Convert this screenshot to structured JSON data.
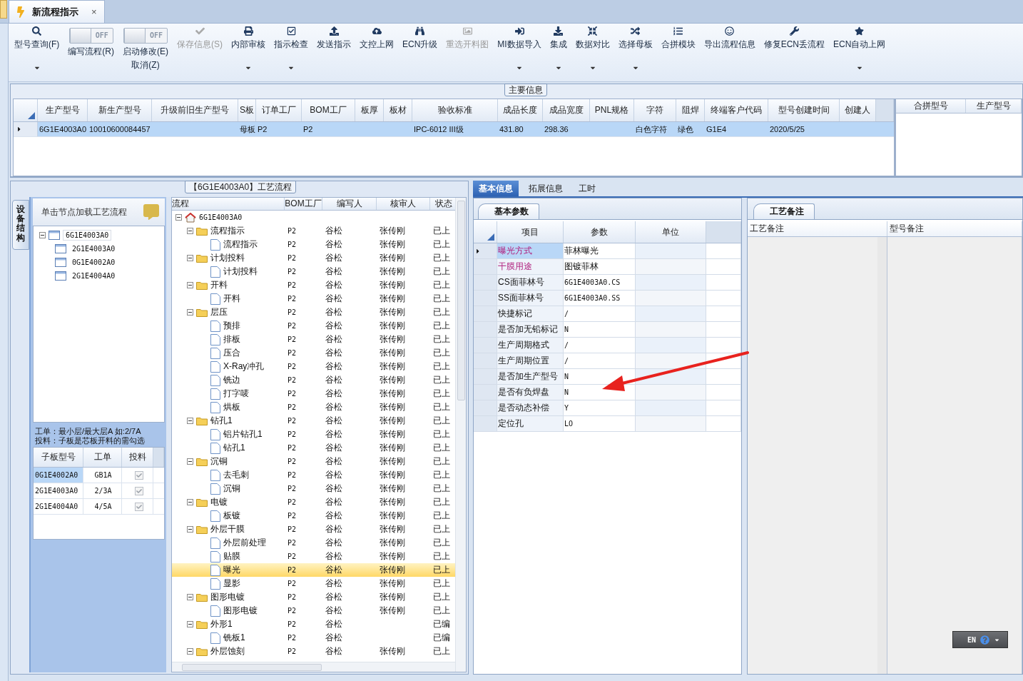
{
  "tab_strip": {
    "tabs": [
      {
        "label": "新流程指示",
        "close": "×",
        "selected": true
      }
    ]
  },
  "toolbar": [
    {
      "kind": "button",
      "label": "型号查询(F)",
      "dropdown": true,
      "disabled": false
    },
    {
      "kind": "toggle",
      "switch_text": "OFF",
      "on": false,
      "label": "编写流程(R)"
    },
    {
      "kind": "toggle",
      "switch_text": "OFF",
      "on": false,
      "label": "启动修改(E)",
      "label_2": "取消(Z)"
    },
    {
      "kind": "button",
      "label": "保存信息(S)",
      "dropdown": false,
      "disabled": true
    },
    {
      "kind": "button",
      "label": "内部审核",
      "dropdown": true,
      "disabled": false
    },
    {
      "kind": "button",
      "label": "指示检查",
      "dropdown": true,
      "disabled": false
    },
    {
      "kind": "button",
      "label": "发送指示",
      "dropdown": false,
      "disabled": false
    },
    {
      "kind": "button",
      "label": "文控上网",
      "dropdown": false,
      "disabled": false
    },
    {
      "kind": "button",
      "label": "ECN升级",
      "dropdown": false,
      "disabled": false
    },
    {
      "kind": "button",
      "label": "重选开料图",
      "dropdown": false,
      "disabled": true
    },
    {
      "kind": "button",
      "label": "MI数据导入",
      "dropdown": true,
      "disabled": false
    },
    {
      "kind": "button",
      "label": "集成",
      "dropdown": true,
      "disabled": false
    },
    {
      "kind": "button",
      "label": "数据对比",
      "dropdown": true,
      "disabled": false
    },
    {
      "kind": "button",
      "label": "选择母板",
      "dropdown": true,
      "disabled": false
    },
    {
      "kind": "button",
      "label": "合拼模块",
      "dropdown": false,
      "disabled": false
    },
    {
      "kind": "button",
      "label": "导出流程信息",
      "dropdown": false,
      "disabled": false
    },
    {
      "kind": "button",
      "label": "修复ECN丢流程",
      "dropdown": false,
      "disabled": false
    },
    {
      "kind": "button",
      "label": "ECN自动上网",
      "dropdown": true,
      "disabled": false
    }
  ],
  "main_info": {
    "legend": "主要信息",
    "columns": [
      "生产型号",
      "新生产型号",
      "升级前旧生产型号",
      "S板",
      "订单工厂",
      "BOM工厂",
      "板厚",
      "板材",
      "验收标准",
      "成品长度",
      "成品宽度",
      "PNL规格",
      "字符",
      "阻焊",
      "终端客户代码",
      "型号创建时间",
      "创建人"
    ],
    "rows": [
      {
        "selected": true,
        "cells": [
          "6G1E4003A0",
          "10010600084457",
          null,
          "母板",
          "P2",
          "P2",
          null,
          null,
          "IPC-6012 III级",
          "431.80",
          "298.36",
          null,
          "白色字符",
          "绿色",
          "G1E4",
          "2020/5/25",
          null
        ]
      }
    ],
    "side_columns": [
      "合拼型号",
      "生产型号"
    ]
  },
  "process": {
    "legend": "【6G1E4003A0】工艺流程",
    "side_tab": "设备结构",
    "hint": "单击节点加载工艺流程",
    "structure_tree": [
      {
        "label": "6G1E4003A0",
        "expanded": true,
        "children": [
          {
            "label": "2G1E4003A0"
          },
          {
            "label": "0G1E4002A0"
          },
          {
            "label": "2G1E4004A0"
          }
        ]
      }
    ],
    "note": [
      "工单：最小层/最大层A 如:2/7A",
      "投料：子板是芯板开料的需勾选"
    ],
    "sub_boards": {
      "columns": [
        "子板型号",
        "工单",
        "投料"
      ],
      "rows": [
        {
          "board": "0G1E4002A0",
          "order": "GB1A",
          "feed": true,
          "selected": true
        },
        {
          "board": "2G1E4003A0",
          "order": "2/3A",
          "feed": true,
          "selected": false
        },
        {
          "board": "2G1E4004A0",
          "order": "4/5A",
          "feed": true,
          "selected": false
        }
      ]
    },
    "flow_grid": {
      "columns": [
        "流程",
        "BOM工厂",
        "编写人",
        "核审人",
        "状态"
      ],
      "tree": [
        {
          "kind": "root",
          "label": "6G1E4003A0",
          "expanded": true,
          "selected": false,
          "children": [
            {
              "kind": "folder",
              "label": "流程指示",
              "expanded": true,
              "bom": "P2",
              "writer": "谷松",
              "reviewer": "张传刚",
              "status": "已上",
              "selected": false,
              "children": [
                {
                  "kind": "file",
                  "label": "流程指示",
                  "bom": "P2",
                  "writer": "谷松",
                  "reviewer": "张传刚",
                  "status": "已上",
                  "selected": false
                }
              ]
            },
            {
              "kind": "folder",
              "label": "计划投料",
              "expanded": true,
              "bom": "P2",
              "writer": "谷松",
              "reviewer": "张传刚",
              "status": "已上",
              "selected": false,
              "children": [
                {
                  "kind": "file",
                  "label": "计划投料",
                  "bom": "P2",
                  "writer": "谷松",
                  "reviewer": "张传刚",
                  "status": "已上",
                  "selected": false
                }
              ]
            },
            {
              "kind": "folder",
              "label": "开料",
              "expanded": true,
              "bom": "P2",
              "writer": "谷松",
              "reviewer": "张传刚",
              "status": "已上",
              "selected": false,
              "children": [
                {
                  "kind": "file",
                  "label": "开料",
                  "bom": "P2",
                  "writer": "谷松",
                  "reviewer": "张传刚",
                  "status": "已上",
                  "selected": false
                }
              ]
            },
            {
              "kind": "folder",
              "label": "层压",
              "expanded": true,
              "bom": "P2",
              "writer": "谷松",
              "reviewer": "张传刚",
              "status": "已上",
              "selected": false,
              "children": [
                {
                  "kind": "file",
                  "label": "预排",
                  "bom": "P2",
                  "writer": "谷松",
                  "reviewer": "张传刚",
                  "status": "已上",
                  "selected": false
                },
                {
                  "kind": "file",
                  "label": "排板",
                  "bom": "P2",
                  "writer": "谷松",
                  "reviewer": "张传刚",
                  "status": "已上",
                  "selected": false
                },
                {
                  "kind": "file",
                  "label": "压合",
                  "bom": "P2",
                  "writer": "谷松",
                  "reviewer": "张传刚",
                  "status": "已上",
                  "selected": false
                },
                {
                  "kind": "file",
                  "label": "X-Ray冲孔",
                  "bom": "P2",
                  "writer": "谷松",
                  "reviewer": "张传刚",
                  "status": "已上",
                  "selected": false
                },
                {
                  "kind": "file",
                  "label": "铣边",
                  "bom": "P2",
                  "writer": "谷松",
                  "reviewer": "张传刚",
                  "status": "已上",
                  "selected": false
                },
                {
                  "kind": "file",
                  "label": "打字唛",
                  "bom": "P2",
                  "writer": "谷松",
                  "reviewer": "张传刚",
                  "status": "已上",
                  "selected": false
                },
                {
                  "kind": "file",
                  "label": "烘板",
                  "bom": "P2",
                  "writer": "谷松",
                  "reviewer": "张传刚",
                  "status": "已上",
                  "selected": false
                }
              ]
            },
            {
              "kind": "folder",
              "label": "钻孔1",
              "expanded": true,
              "bom": "P2",
              "writer": "谷松",
              "reviewer": "张传刚",
              "status": "已上",
              "selected": false,
              "children": [
                {
                  "kind": "file",
                  "label": "铝片钻孔1",
                  "bom": "P2",
                  "writer": "谷松",
                  "reviewer": "张传刚",
                  "status": "已上",
                  "selected": false
                },
                {
                  "kind": "file",
                  "label": "钻孔1",
                  "bom": "P2",
                  "writer": "谷松",
                  "reviewer": "张传刚",
                  "status": "已上",
                  "selected": false
                }
              ]
            },
            {
              "kind": "folder",
              "label": "沉铜",
              "expanded": true,
              "bom": "P2",
              "writer": "谷松",
              "reviewer": "张传刚",
              "status": "已上",
              "selected": false,
              "children": [
                {
                  "kind": "file",
                  "label": "去毛刺",
                  "bom": "P2",
                  "writer": "谷松",
                  "reviewer": "张传刚",
                  "status": "已上",
                  "selected": false
                },
                {
                  "kind": "file",
                  "label": "沉铜",
                  "bom": "P2",
                  "writer": "谷松",
                  "reviewer": "张传刚",
                  "status": "已上",
                  "selected": false
                }
              ]
            },
            {
              "kind": "folder",
              "label": "电镀",
              "expanded": true,
              "bom": "P2",
              "writer": "谷松",
              "reviewer": "张传刚",
              "status": "已上",
              "selected": false,
              "children": [
                {
                  "kind": "file",
                  "label": "板镀",
                  "bom": "P2",
                  "writer": "谷松",
                  "reviewer": "张传刚",
                  "status": "已上",
                  "selected": false
                }
              ]
            },
            {
              "kind": "folder",
              "label": "外层干膜",
              "expanded": true,
              "bom": "P2",
              "writer": "谷松",
              "reviewer": "张传刚",
              "status": "已上",
              "selected": false,
              "children": [
                {
                  "kind": "file",
                  "label": "外层前处理",
                  "bom": "P2",
                  "writer": "谷松",
                  "reviewer": "张传刚",
                  "status": "已上",
                  "selected": false
                },
                {
                  "kind": "file",
                  "label": "贴膜",
                  "bom": "P2",
                  "writer": "谷松",
                  "reviewer": "张传刚",
                  "status": "已上",
                  "selected": false
                },
                {
                  "kind": "file",
                  "label": "曝光",
                  "bom": "P2",
                  "writer": "谷松",
                  "reviewer": "张传刚",
                  "status": "已上",
                  "selected": true
                },
                {
                  "kind": "file",
                  "label": "显影",
                  "bom": "P2",
                  "writer": "谷松",
                  "reviewer": "张传刚",
                  "status": "已上",
                  "selected": false
                }
              ]
            },
            {
              "kind": "folder",
              "label": "图形电镀",
              "expanded": true,
              "bom": "P2",
              "writer": "谷松",
              "reviewer": "张传刚",
              "status": "已上",
              "selected": false,
              "children": [
                {
                  "kind": "file",
                  "label": "图形电镀",
                  "bom": "P2",
                  "writer": "谷松",
                  "reviewer": "张传刚",
                  "status": "已上",
                  "selected": false
                }
              ]
            },
            {
              "kind": "folder",
              "label": "外形1",
              "expanded": true,
              "bom": "P2",
              "writer": "谷松",
              "status": "已编",
              "selected": false,
              "children": [
                {
                  "kind": "file",
                  "label": "铣板1",
                  "bom": "P2",
                  "writer": "谷松",
                  "status": "已编",
                  "selected": false
                }
              ]
            },
            {
              "kind": "folder",
              "label": "外层蚀刻",
              "expanded": true,
              "bom": "P2",
              "writer": "谷松",
              "reviewer": "张传刚",
              "status": "已上",
              "selected": false
            }
          ]
        }
      ]
    }
  },
  "details": {
    "tabs": [
      {
        "label": "基本信息",
        "selected": true
      },
      {
        "label": "拓展信息",
        "selected": false
      },
      {
        "label": "工时",
        "selected": false
      }
    ],
    "params": {
      "tab": "基本参数",
      "columns": [
        "项目",
        "参数",
        "单位"
      ],
      "rows": [
        {
          "item": "曝光方式",
          "value": "菲林曝光",
          "emphasized": true,
          "selected": true
        },
        {
          "item": "干膜用途",
          "value": "图镀菲林",
          "emphasized": true,
          "selected": false
        },
        {
          "item": "CS面菲林号",
          "value": "6G1E4003A0.CS",
          "emphasized": false,
          "selected": false
        },
        {
          "item": "SS面菲林号",
          "value": "6G1E4003A0.SS",
          "emphasized": false,
          "selected": false
        },
        {
          "item": "快捷标记",
          "value": "/",
          "emphasized": false,
          "selected": false
        },
        {
          "item": "是否加无铅标记",
          "value": "N",
          "emphasized": false,
          "selected": false
        },
        {
          "item": "生产周期格式",
          "value": "/",
          "emphasized": false,
          "selected": false
        },
        {
          "item": "生产周期位置",
          "value": "/",
          "emphasized": false,
          "selected": false
        },
        {
          "item": "是否加生产型号",
          "value": "N",
          "emphasized": false,
          "selected": false
        },
        {
          "item": "是否有负焊盘",
          "value": "N",
          "emphasized": false,
          "selected": false
        },
        {
          "item": "是否动态补偿",
          "value": "Y",
          "emphasized": false,
          "selected": false
        },
        {
          "item": "定位孔",
          "value": "LO",
          "emphasized": false,
          "selected": false
        }
      ]
    },
    "remarks": {
      "tab": "工艺备注",
      "columns": [
        "工艺备注",
        "型号备注"
      ]
    }
  },
  "language_bar": {
    "label": "EN"
  }
}
